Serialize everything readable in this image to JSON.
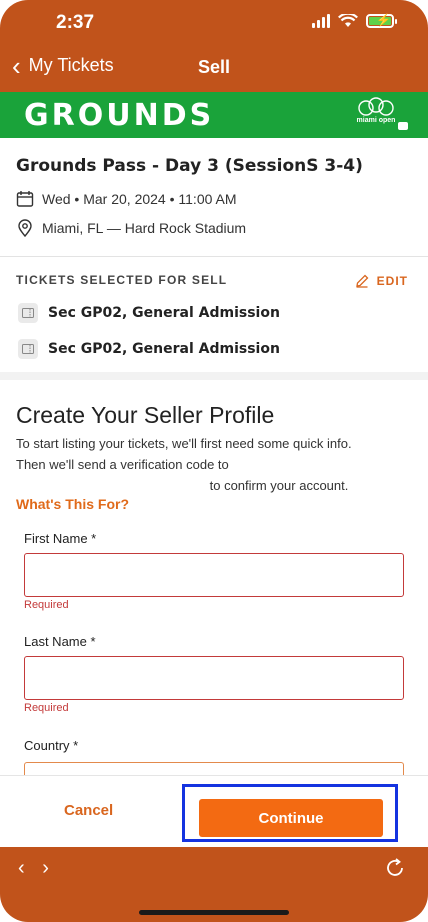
{
  "status_bar": {
    "time": "2:37"
  },
  "nav": {
    "back_label": "My Tickets",
    "title": "Sell"
  },
  "banner": {
    "title": "GROUNDS",
    "logo_text": "miami open"
  },
  "event": {
    "name": "Grounds Pass - Day 3 (SessionS 3-4)",
    "datetime": "Wed • Mar 20, 2024 • 11:00 AM",
    "location": "Miami, FL — Hard Rock Stadium"
  },
  "tickets": {
    "section_label": "TICKETS SELECTED FOR SELL",
    "edit_label": "EDIT",
    "items": [
      {
        "label": "Sec GP02, General Admission"
      },
      {
        "label": "Sec GP02, General Admission"
      }
    ]
  },
  "form": {
    "title": "Create Your Seller Profile",
    "desc_line1": "To start listing your tickets, we'll first need some quick info.",
    "desc_line2": "Then we'll send a verification code to",
    "desc_line3_suffix": "to confirm your account.",
    "whats_this": "What's This For?",
    "first_name": {
      "label": "First Name *",
      "value": "",
      "error": "Required"
    },
    "last_name": {
      "label": "Last Name *",
      "value": "",
      "error": "Required"
    },
    "country": {
      "label": "Country *"
    }
  },
  "footer": {
    "cancel_label": "Cancel",
    "continue_label": "Continue"
  },
  "browser": {
    "nav_arrows": "‹ ›"
  },
  "colors": {
    "brand": "#c1531b",
    "banner": "#1aa33a",
    "accent": "#f36a12",
    "error": "#c33a3a",
    "highlight": "#1433e0"
  }
}
